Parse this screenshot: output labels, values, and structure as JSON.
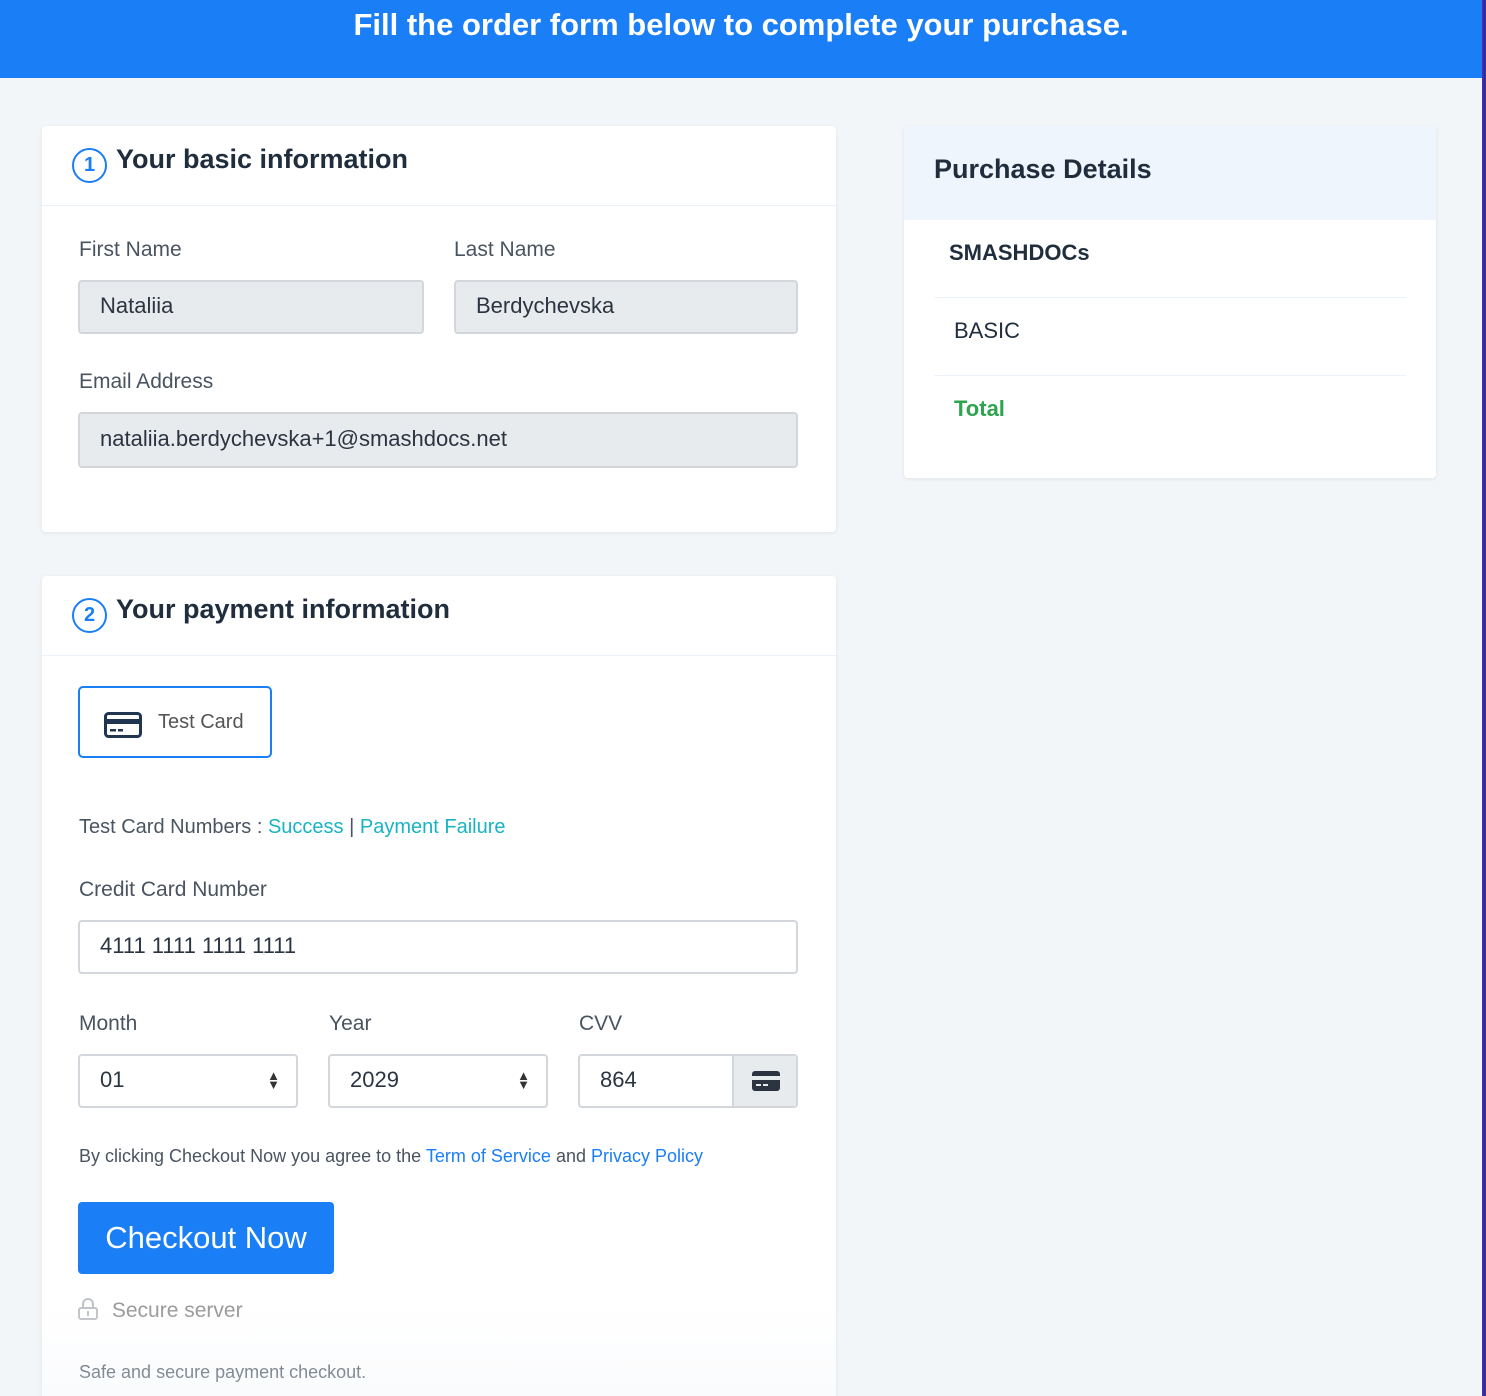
{
  "header": {
    "title": "Fill the order form below to complete your purchase."
  },
  "basic_info": {
    "step": "1",
    "title": "Your basic information",
    "first_name_label": "First Name",
    "first_name_value": "Nataliia",
    "last_name_label": "Last Name",
    "last_name_value": "Berdychevska",
    "email_label": "Email Address",
    "email_value": "nataliia.berdychevska+1@smashdocs.net"
  },
  "payment_info": {
    "step": "2",
    "title": "Your payment information",
    "method_label": "Test Card",
    "test_numbers_label": "Test Card Numbers :",
    "success_link": "Success",
    "separator": "|",
    "failure_link": "Payment Failure",
    "card_number_label": "Credit Card Number",
    "card_number_value": "4111 1111 1111 1111",
    "month_label": "Month",
    "month_value": "01",
    "year_label": "Year",
    "year_value": "2029",
    "cvv_label": "CVV",
    "cvv_value": "864",
    "agree_prefix": "By clicking Checkout Now you agree to the",
    "terms_link": "Term of Service",
    "agree_and": "and",
    "privacy_link": "Privacy Policy",
    "checkout_button": "Checkout Now",
    "secure_label": "Secure server",
    "safe_label": "Safe and secure payment checkout."
  },
  "purchase": {
    "title": "Purchase Details",
    "product": "SMASHDOCs",
    "plan": "BASIC",
    "total_label": "Total"
  },
  "colors": {
    "primary": "#1a7ef7",
    "teal_link": "#18b4c2",
    "total_green": "#2ea44f"
  },
  "icons": {
    "card": "credit-card-icon",
    "lock": "lock-icon",
    "select": "chevron-updown-icon"
  }
}
